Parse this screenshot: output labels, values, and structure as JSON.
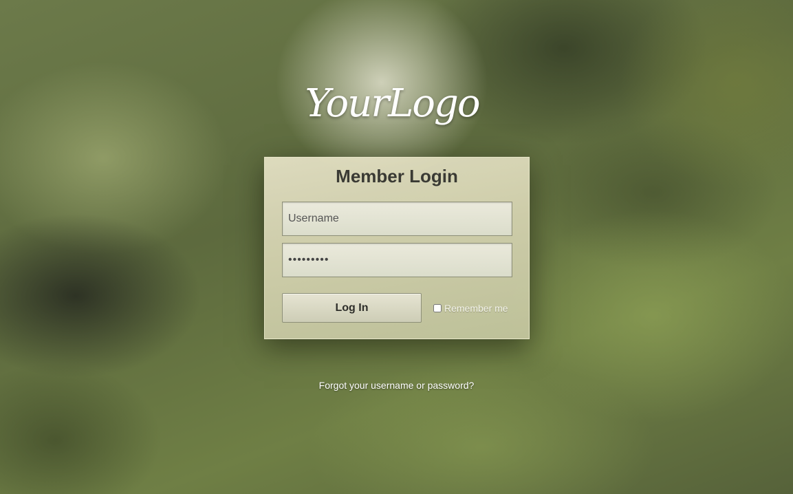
{
  "logo": {
    "text": "YourLogo"
  },
  "login_panel": {
    "title": "Member Login",
    "username_placeholder": "Username",
    "password_value": "•••••••••",
    "login_button_label": "Log In",
    "remember_label": "Remember me",
    "remember_checked": false
  },
  "footer": {
    "forgot_link": "Forgot your username or password?"
  },
  "colors": {
    "background": "#6c7a4a",
    "panel": "#d6d4b2",
    "title_text": "#3a3a34"
  }
}
